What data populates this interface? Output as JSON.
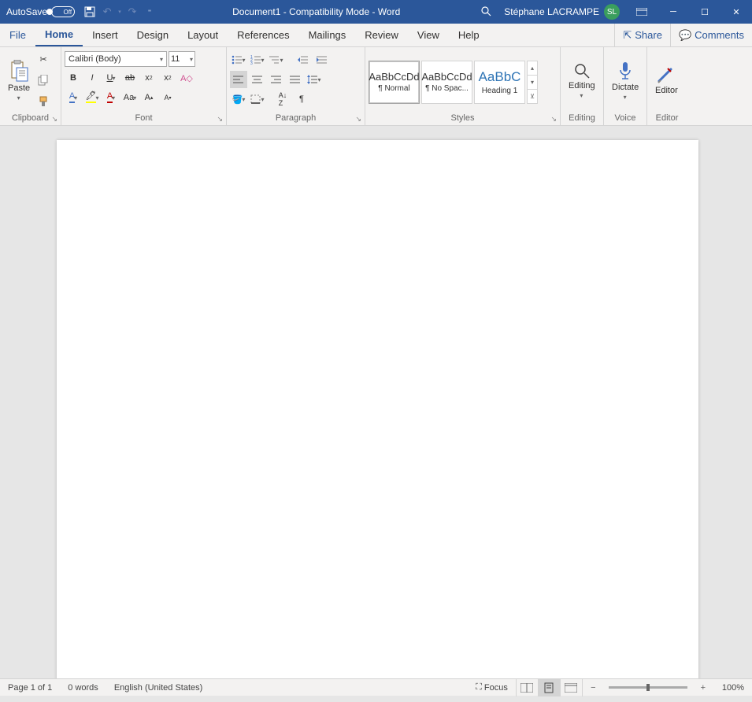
{
  "titlebar": {
    "autosave_label": "AutoSave",
    "autosave_state": "Off",
    "title": "Document1  -  Compatibility Mode  -  Word",
    "user_name": "Stéphane LACRAMPE",
    "user_initials": "SL"
  },
  "tabs": {
    "file": "File",
    "home": "Home",
    "insert": "Insert",
    "design": "Design",
    "layout": "Layout",
    "references": "References",
    "mailings": "Mailings",
    "review": "Review",
    "view": "View",
    "help": "Help",
    "share": "Share",
    "comments": "Comments"
  },
  "ribbon": {
    "clipboard": {
      "label": "Clipboard",
      "paste": "Paste"
    },
    "font": {
      "label": "Font",
      "name": "Calibri (Body)",
      "size": "11"
    },
    "paragraph": {
      "label": "Paragraph"
    },
    "styles": {
      "label": "Styles",
      "items": [
        {
          "preview": "AaBbCcDd",
          "name": "¶ Normal"
        },
        {
          "preview": "AaBbCcDd",
          "name": "¶ No Spac..."
        },
        {
          "preview": "AaBbC",
          "name": "Heading 1"
        }
      ]
    },
    "editing": {
      "label": "Editing",
      "button": "Editing"
    },
    "voice": {
      "label": "Voice",
      "button": "Dictate"
    },
    "editor": {
      "label": "Editor",
      "button": "Editor"
    }
  },
  "statusbar": {
    "page": "Page 1 of 1",
    "words": "0 words",
    "language": "English (United States)",
    "focus": "Focus",
    "zoom": "100%"
  }
}
